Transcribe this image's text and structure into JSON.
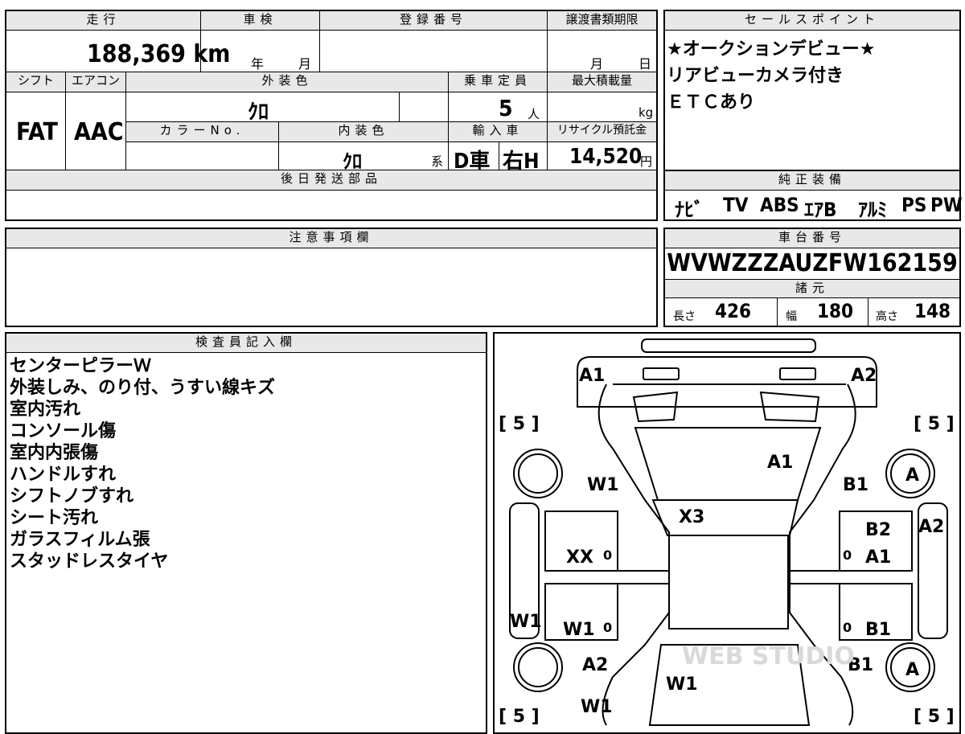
{
  "main_table": {
    "headers": {
      "mileage": "走行",
      "inspection": "車検",
      "registration_number": "登録番号",
      "transfer_deadline": "譲渡書類期限",
      "shift": "シフト",
      "aircon": "エアコン",
      "exterior_color": "外装色",
      "seating_capacity": "乗車定員",
      "max_load": "最大積載量",
      "color_no": "カラーNo.",
      "interior_color": "内装色",
      "import": "輸入車",
      "recycle_fee": "リサイクル預託金",
      "later_shipment": "後日発送部品"
    },
    "mileage_value": "188,369 km",
    "inspection_year_unit": "年",
    "inspection_month_unit": "月",
    "transfer_month_unit": "月",
    "transfer_day_unit": "日",
    "shift_value": "FAT",
    "aircon_value": "AAC",
    "exterior_color_value": "ｸﾛ",
    "seating_capacity_value": "5",
    "seating_unit": "人",
    "max_load_unit": "kg",
    "interior_color_value": "ｸﾛ",
    "interior_color_suffix": "系",
    "import_type": "D車",
    "steering": "右H",
    "recycle_fee_value": "14,520",
    "recycle_fee_unit": "円"
  },
  "sales_points": {
    "header": "セールスポイント",
    "lines": [
      "★オークションデビュー★",
      "リアビューカメラ付き",
      "ＥＴＣあり"
    ]
  },
  "genuine_equipment": {
    "header": "純正装備",
    "items": [
      "ﾅﾋﾞ",
      "TV",
      "ABS",
      "ｴｱB",
      "ｱﾙﾐ",
      "PS",
      "PW"
    ]
  },
  "caution": {
    "header": "注意事項欄"
  },
  "chassis": {
    "header": "車台番号",
    "number": "WVWZZZAUZFW162159",
    "specs_header": "諸元",
    "length_label": "長さ",
    "length_value": "426",
    "width_label": "幅",
    "width_value": "180",
    "height_label": "高さ",
    "height_value": "148"
  },
  "inspector_notes": {
    "header": "検査員記入欄",
    "lines": [
      "センターピラーＷ",
      "外装しみ、のり付、うすい線キズ",
      "室内汚れ",
      "コンソール傷",
      "室内内張傷",
      "ハンドルすれ",
      "シフトノブすれ",
      "シート汚れ",
      "ガラスフィルム張",
      "スタッドレスタイヤ"
    ]
  },
  "diagram": {
    "marks": [
      "A1",
      "A2",
      "A1",
      "W1",
      "B1",
      "X3",
      "B2",
      "A2",
      "XX",
      "A1",
      "W1",
      "W1",
      "B1",
      "A2",
      "B1",
      "W1",
      "W1"
    ],
    "tire_labels": [
      "A",
      "A"
    ],
    "tread_labels": [
      "[ 5 ]",
      "[ 5 ]",
      "[ 5 ]",
      "[ 5 ]"
    ],
    "zero_marks": [
      "0",
      "0",
      "0",
      "0"
    ],
    "watermark": "WEB STUDIO"
  }
}
